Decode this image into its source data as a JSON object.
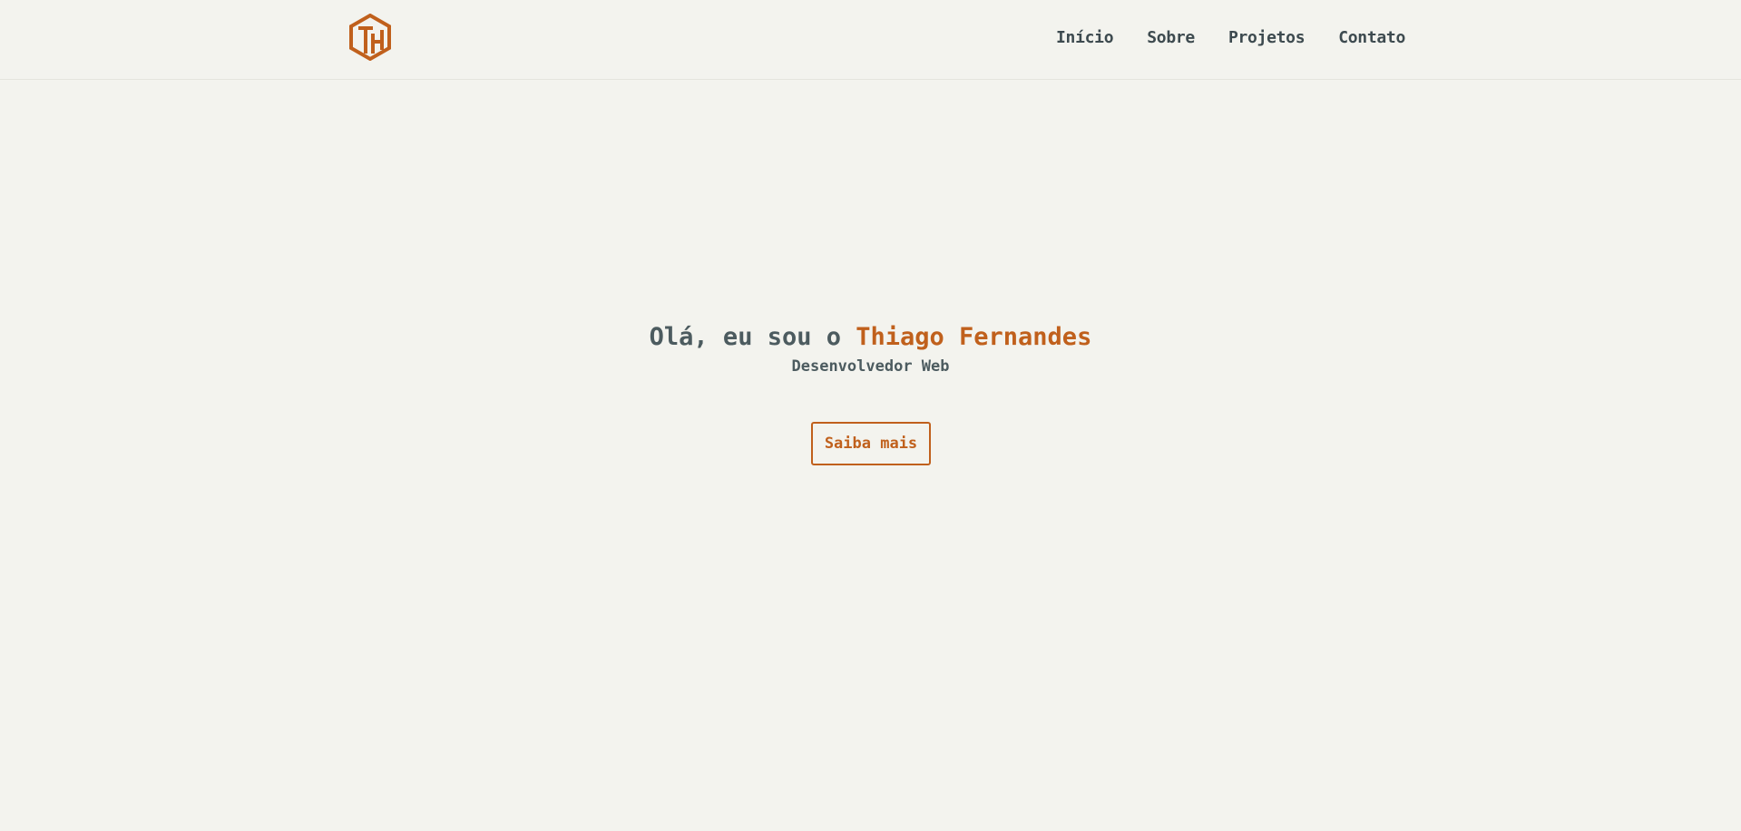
{
  "header": {
    "logo_text": "TH",
    "brand_color": "#c0601c",
    "nav": [
      {
        "label": "Início"
      },
      {
        "label": "Sobre"
      },
      {
        "label": "Projetos"
      },
      {
        "label": "Contato"
      }
    ]
  },
  "hero": {
    "greeting": "Olá, eu sou o ",
    "name": "Thiago Fernandes",
    "subtitle": "Desenvolvedor Web",
    "cta_label": "Saiba mais"
  },
  "colors": {
    "background": "#f3f3ee",
    "text": "#4c5b5f",
    "accent": "#c0601c"
  }
}
